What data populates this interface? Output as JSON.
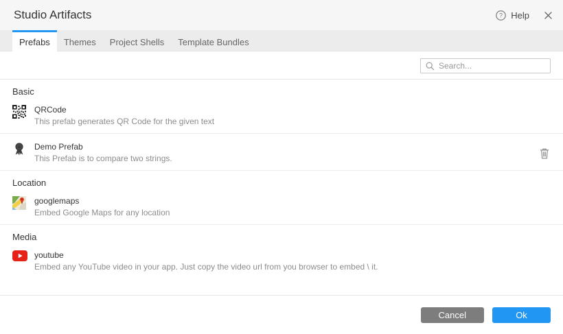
{
  "dialog": {
    "title": "Studio Artifacts",
    "help_label": "Help"
  },
  "tabs": [
    {
      "label": "Prefabs",
      "active": true
    },
    {
      "label": "Themes",
      "active": false
    },
    {
      "label": "Project Shells",
      "active": false
    },
    {
      "label": "Template Bundles",
      "active": false
    }
  ],
  "search": {
    "placeholder": "Search...",
    "value": ""
  },
  "sections": [
    {
      "name": "Basic",
      "items": [
        {
          "icon": "qrcode-icon",
          "title": "QRCode",
          "description": "This prefab generates QR Code for the given text",
          "deletable": false
        },
        {
          "icon": "award-ribbon-icon",
          "title": "Demo Prefab",
          "description": "This Prefab is to compare two strings.",
          "deletable": true
        }
      ]
    },
    {
      "name": "Location",
      "items": [
        {
          "icon": "google-maps-icon",
          "title": "googlemaps",
          "description": "Embed Google Maps for any location",
          "deletable": false
        }
      ]
    },
    {
      "name": "Media",
      "items": [
        {
          "icon": "youtube-icon",
          "title": "youtube",
          "description": "Embed any YouTube video in your app. Just copy the video url from you browser to embed \\ it.",
          "deletable": false
        }
      ]
    }
  ],
  "footer": {
    "cancel_label": "Cancel",
    "ok_label": "Ok"
  },
  "colors": {
    "accent": "#2196f3",
    "cancel_button": "#7d7d7d",
    "youtube_red": "#e62117",
    "header_bg": "#f6f6f6",
    "tabbar_bg": "#ececec"
  }
}
